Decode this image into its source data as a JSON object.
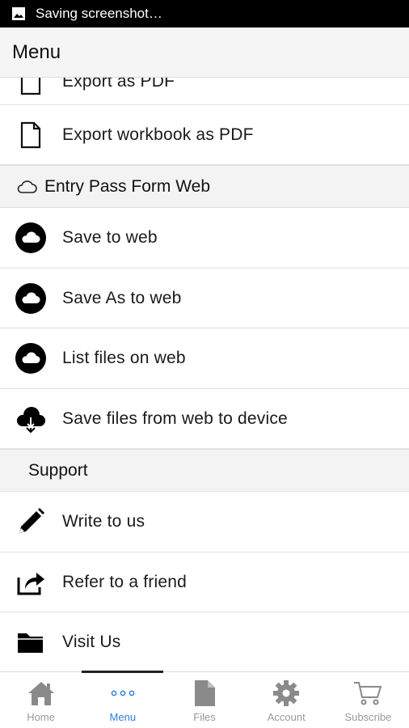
{
  "status_bar": {
    "text": "Saving screenshot…",
    "icon": "image-icon"
  },
  "app_bar": {
    "title": "Menu"
  },
  "menu": {
    "partial_item": {
      "label": "Export as PDF",
      "icon": "file-icon"
    },
    "export_workbook": {
      "label": "Export workbook as PDF",
      "icon": "file-icon"
    },
    "web_section": {
      "label": "Entry Pass Form Web",
      "icon": "cloud-outline-icon"
    },
    "save_to_web": {
      "label": "Save to web",
      "icon": "cloud-icon"
    },
    "save_as_to_web": {
      "label": "Save As to web",
      "icon": "cloud-icon"
    },
    "list_files": {
      "label": "List files on web",
      "icon": "cloud-icon"
    },
    "save_files_device": {
      "label": "Save files from web to device",
      "icon": "cloud-download-icon"
    },
    "support_section": {
      "label": "Support"
    },
    "write_to_us": {
      "label": "Write to us",
      "icon": "pencil-icon"
    },
    "refer_friend": {
      "label": "Refer to a friend",
      "icon": "share-icon"
    },
    "visit_us": {
      "label": "Visit Us",
      "icon": "folder-icon"
    }
  },
  "tabs": [
    {
      "label": "Home",
      "icon": "home-icon",
      "active": false
    },
    {
      "label": "Menu",
      "icon": "more-dots-icon",
      "active": true
    },
    {
      "label": "Files",
      "icon": "document-icon",
      "active": false
    },
    {
      "label": "Account",
      "icon": "gear-icon",
      "active": false
    },
    {
      "label": "Subscribe",
      "icon": "cart-icon",
      "active": false
    }
  ],
  "colors": {
    "active_tab": "#2f7fe0",
    "inactive_tab": "#999999",
    "section_bg": "#f3f3f3"
  }
}
